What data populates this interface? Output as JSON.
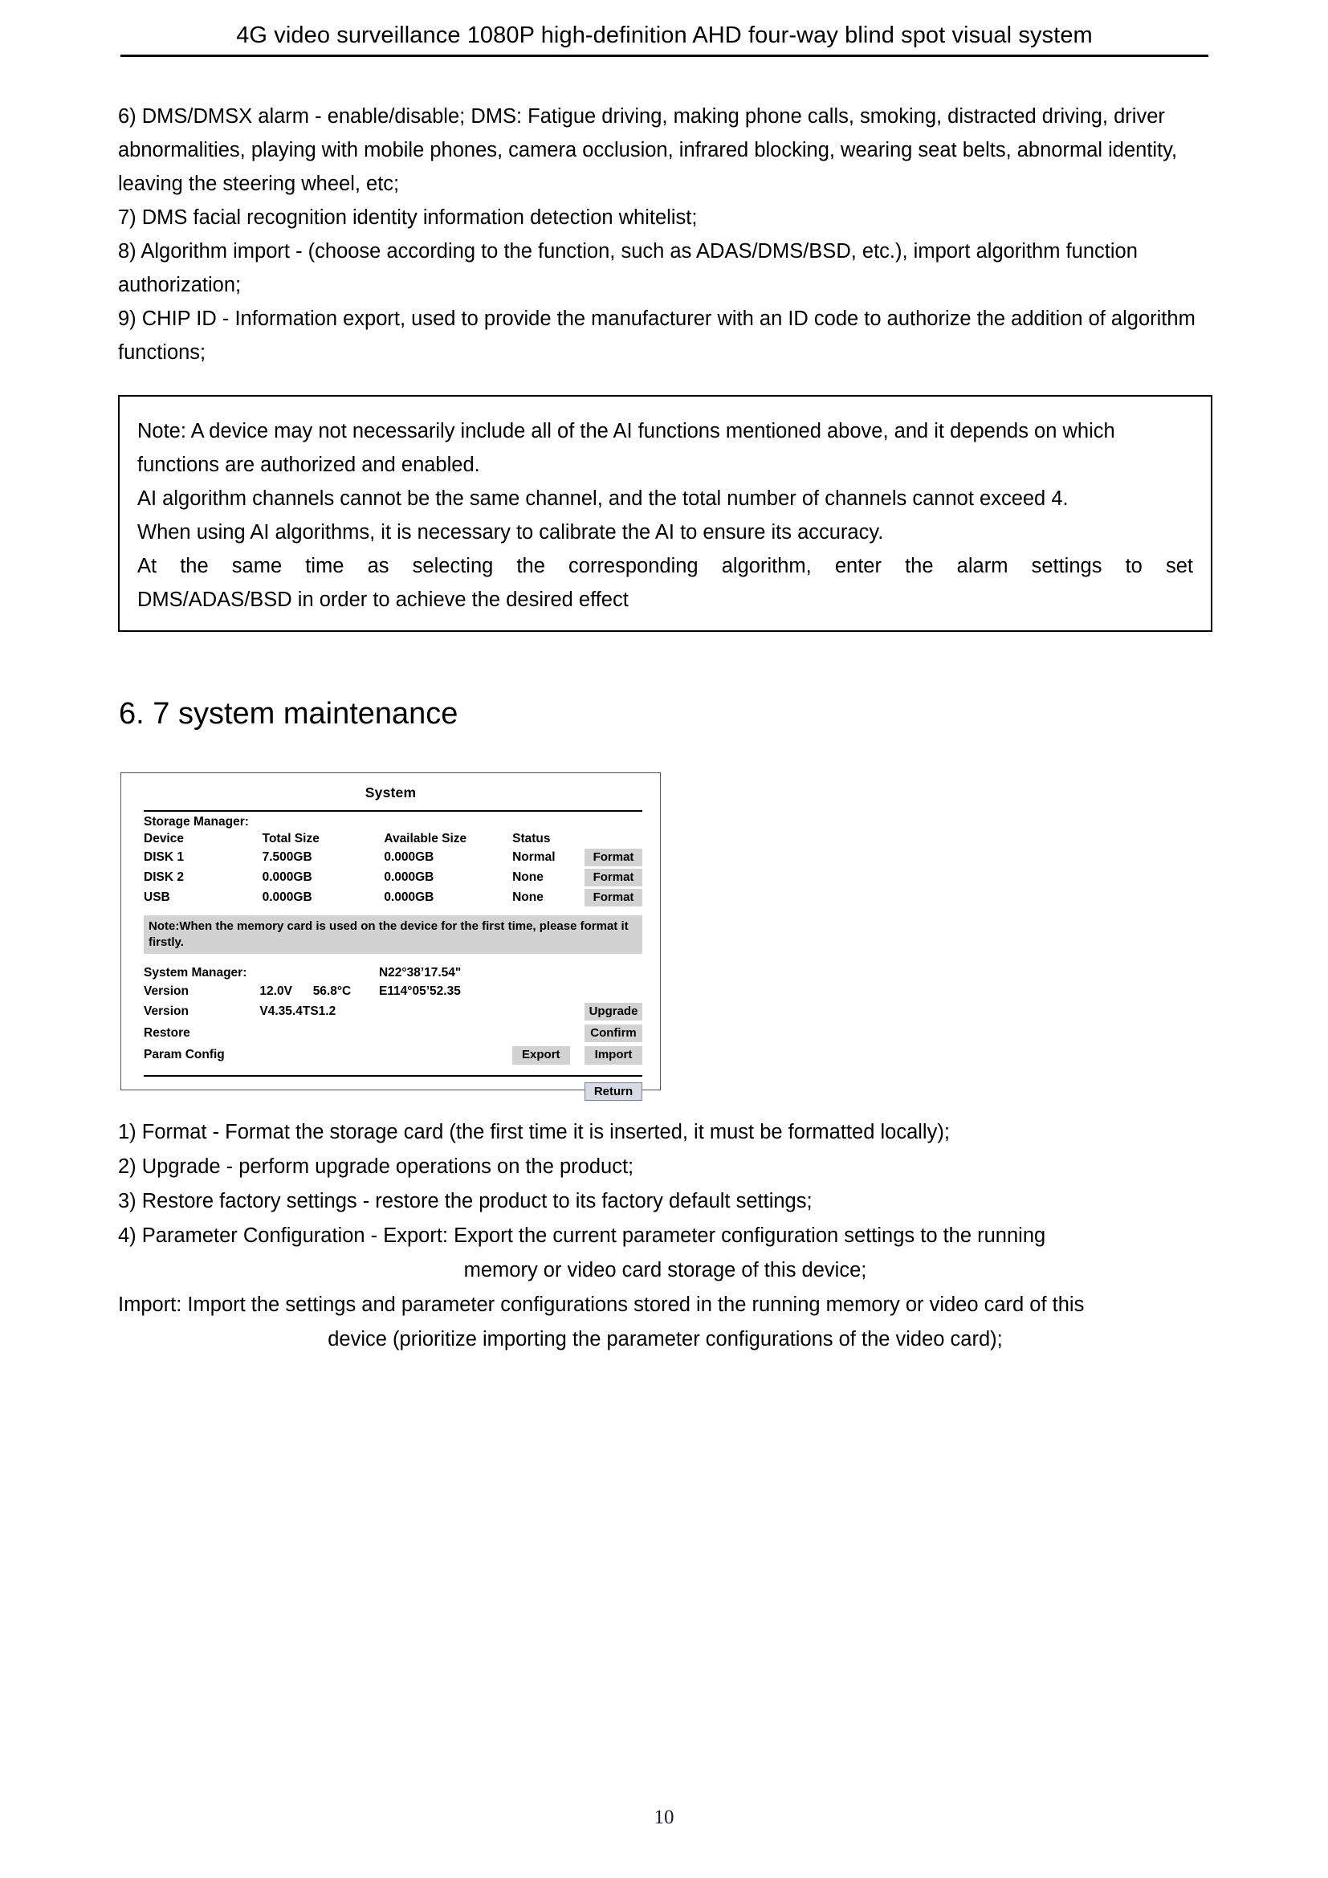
{
  "header": {
    "title": "4G video surveillance 1080P high-definition AHD four-way blind spot visual system"
  },
  "body_paragraphs": [
    "6) DMS/DMSX alarm - enable/disable; DMS: Fatigue driving, making phone calls, smoking, distracted driving, driver abnormalities, playing with mobile phones, camera occlusion, infrared blocking, wearing seat belts, abnormal identity, leaving the steering wheel, etc;",
    "7) DMS facial recognition identity information detection whitelist;",
    "8) Algorithm import - (choose according to the function, such as ADAS/DMS/BSD, etc.), import algorithm function authorization;",
    "9) CHIP ID - Information export, used to provide the manufacturer with an ID code to authorize the addition of algorithm functions;"
  ],
  "note_box": {
    "line1": "Note: A device may not necessarily include all of the AI functions mentioned above, and it depends on which functions are authorized and enabled.",
    "line2": "AI algorithm channels cannot be the same channel, and the total number of channels cannot exceed 4.",
    "line3": "When using AI algorithms, it is necessary to calibrate the AI to ensure its accuracy.",
    "line4": "At the same time as selecting the corresponding algorithm, enter the alarm settings to set",
    "line5": "DMS/ADAS/BSD in order to achieve the desired effect"
  },
  "section": {
    "heading": "6. 7 system maintenance"
  },
  "device_panel": {
    "title": "System",
    "storage_manager_label": "Storage Manager:",
    "storage_columns": [
      "Device",
      "Total Size",
      "Available Size",
      "Status",
      ""
    ],
    "storage_rows": [
      {
        "device": "DISK 1",
        "total": "7.500GB",
        "available": "0.000GB",
        "status": "Normal",
        "action": "Format"
      },
      {
        "device": "DISK 2",
        "total": "0.000GB",
        "available": "0.000GB",
        "status": "None",
        "action": "Format"
      },
      {
        "device": "USB",
        "total": "0.000GB",
        "available": "0.000GB",
        "status": "None",
        "action": "Format"
      }
    ],
    "storage_note": "Note:When the memory card is used on the device for the first time, please format it firstly.",
    "system_manager_label": "System Manager:",
    "gps_north": "N22°38’17.54ʺ",
    "gps_east": "E114°05’52.35",
    "row_version_power_label": "Version",
    "voltage": "12.0V",
    "temperature": "56.8°C",
    "row_version_label": "Version",
    "version_value": "V4.35.4TS1.2",
    "upgrade_button": "Upgrade",
    "restore_label": "Restore",
    "confirm_button": "Confirm",
    "param_config_label": "Param Config",
    "export_button": "Export",
    "import_button": "Import",
    "return_button": "Return",
    "colors": {
      "button_gray": "#d2d2d2",
      "note_gray": "#d2d2d2",
      "return_fill": "#d7d9e4",
      "return_border": "#7a7f9c"
    }
  },
  "list_items": {
    "item1": "1) Format - Format the storage card (the first time it is inserted, it must be formatted locally);",
    "item2": "2) Upgrade - perform upgrade operations on the product;",
    "item3": "3) Restore factory settings - restore the product to its factory default settings;",
    "item4_line1": "4) Parameter Configuration - Export: Export the current parameter configuration settings to the running",
    "item4_line2": "memory or video card storage of this device;",
    "item5_line1": "Import: Import the settings and parameter configurations stored in the running memory or video card of this",
    "item5_line2": "device (prioritize importing the parameter configurations of the video card);"
  },
  "footer": {
    "page_number": "10"
  }
}
